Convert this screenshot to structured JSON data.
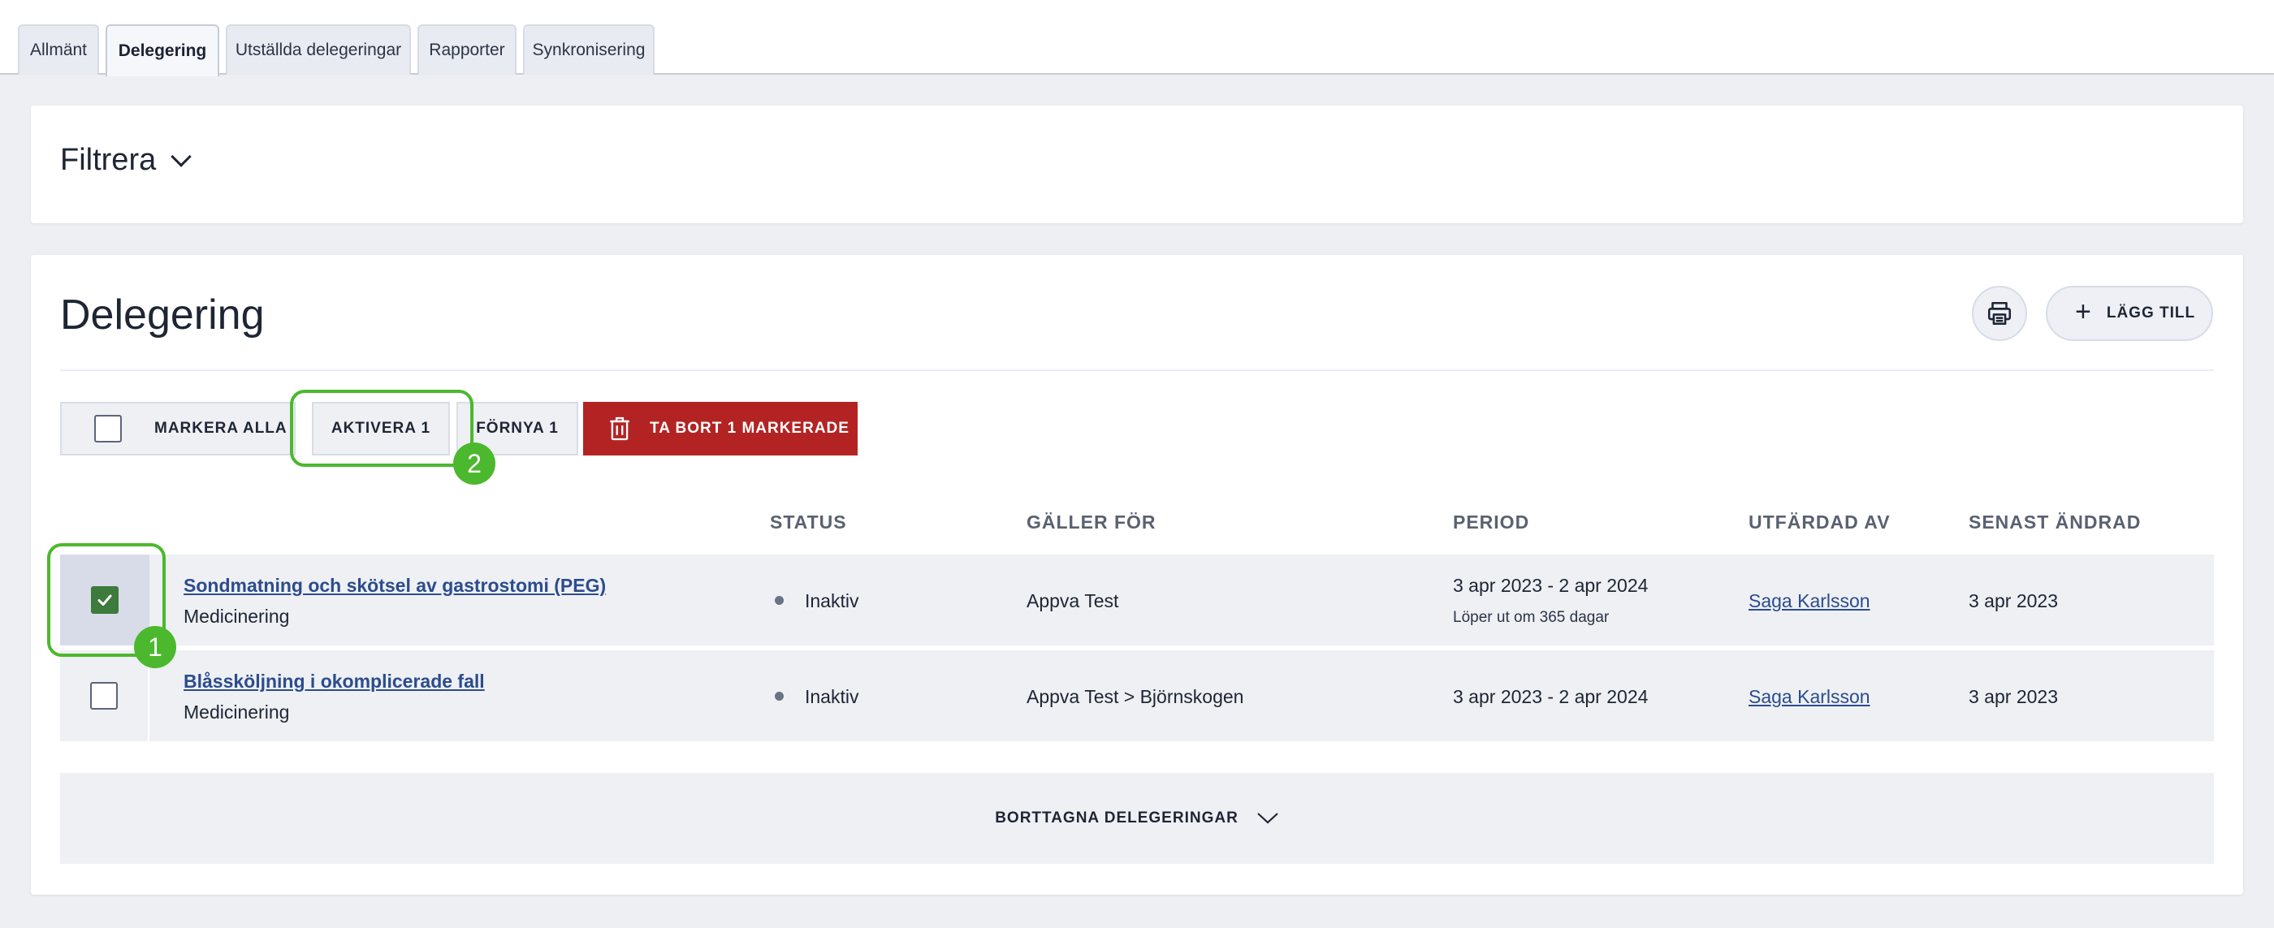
{
  "tabs": [
    "Allmänt",
    "Delegering",
    "Utställda delegeringar",
    "Rapporter",
    "Synkronisering"
  ],
  "active_tab": "Delegering",
  "filter": {
    "label": "Filtrera"
  },
  "section": {
    "title": "Delegering",
    "add_label": "LÄGG TILL"
  },
  "actions": {
    "select_all": "MARKERA ALLA",
    "activate": "AKTIVERA 1",
    "renew": "FÖRNYA 1",
    "delete": "TA BORT 1 MARKERADE"
  },
  "annotations": {
    "badge1": "1",
    "badge2": "2"
  },
  "table": {
    "headers": [
      "STATUS",
      "GÄLLER FÖR",
      "PERIOD",
      "UTFÄRDAD AV",
      "SENAST ÄNDRAD"
    ],
    "rows": [
      {
        "checked": true,
        "title": "Sondmatning och skötsel av gastrostomi (PEG)",
        "category": "Medicinering",
        "status": "Inaktiv",
        "applies_to": "Appva Test",
        "period": "3 apr 2023 - 2 apr 2024",
        "period_note": "Löper ut om 365 dagar",
        "issued_by": "Saga Karlsson",
        "last_changed": "3 apr 2023"
      },
      {
        "checked": false,
        "title": "Blåssköljning i okomplicerade fall",
        "category": "Medicinering",
        "status": "Inaktiv",
        "applies_to": "Appva Test > Björnskogen",
        "period": "3 apr 2023 - 2 apr 2024",
        "period_note": "",
        "issued_by": "Saga Karlsson",
        "last_changed": "3 apr 2023"
      }
    ]
  },
  "deleted": {
    "label": "BORTTAGNA DELEGERINGAR"
  },
  "colors": {
    "accent_green": "#4cb82e",
    "danger": "#b42323",
    "link": "#2c4c8c",
    "checkbox_checked": "#3d7a3b"
  }
}
